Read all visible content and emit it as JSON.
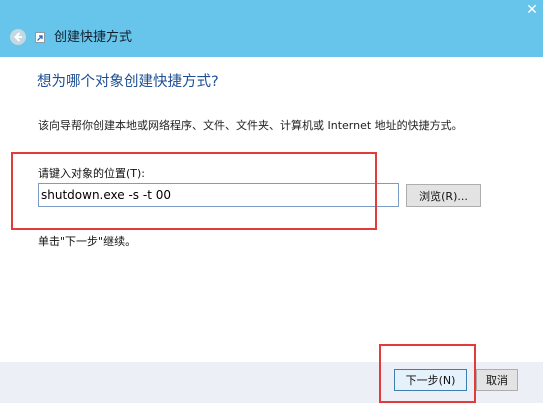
{
  "window": {
    "title": "创建快捷方式",
    "close_glyph": "✕"
  },
  "main": {
    "heading": "想为哪个对象创建快捷方式?",
    "description": "该向导帮你创建本地或网络程序、文件、文件夹、计算机或 Internet 地址的快捷方式。",
    "field_label": "请键入对象的位置(T):",
    "location_value": "shutdown.exe -s -t 00",
    "browse_label": "浏览(R)...",
    "hint": "单击\"下一步\"继续。"
  },
  "footer": {
    "next_label": "下一步(N)",
    "cancel_label": "取消"
  },
  "colors": {
    "titlebar": "#67c4ea",
    "heading": "#1d4f92",
    "highlight": "#e33a3a",
    "footer": "#ecf0f6"
  },
  "icons": [
    "close-icon",
    "back-arrow-icon",
    "shortcut-wizard-icon"
  ]
}
